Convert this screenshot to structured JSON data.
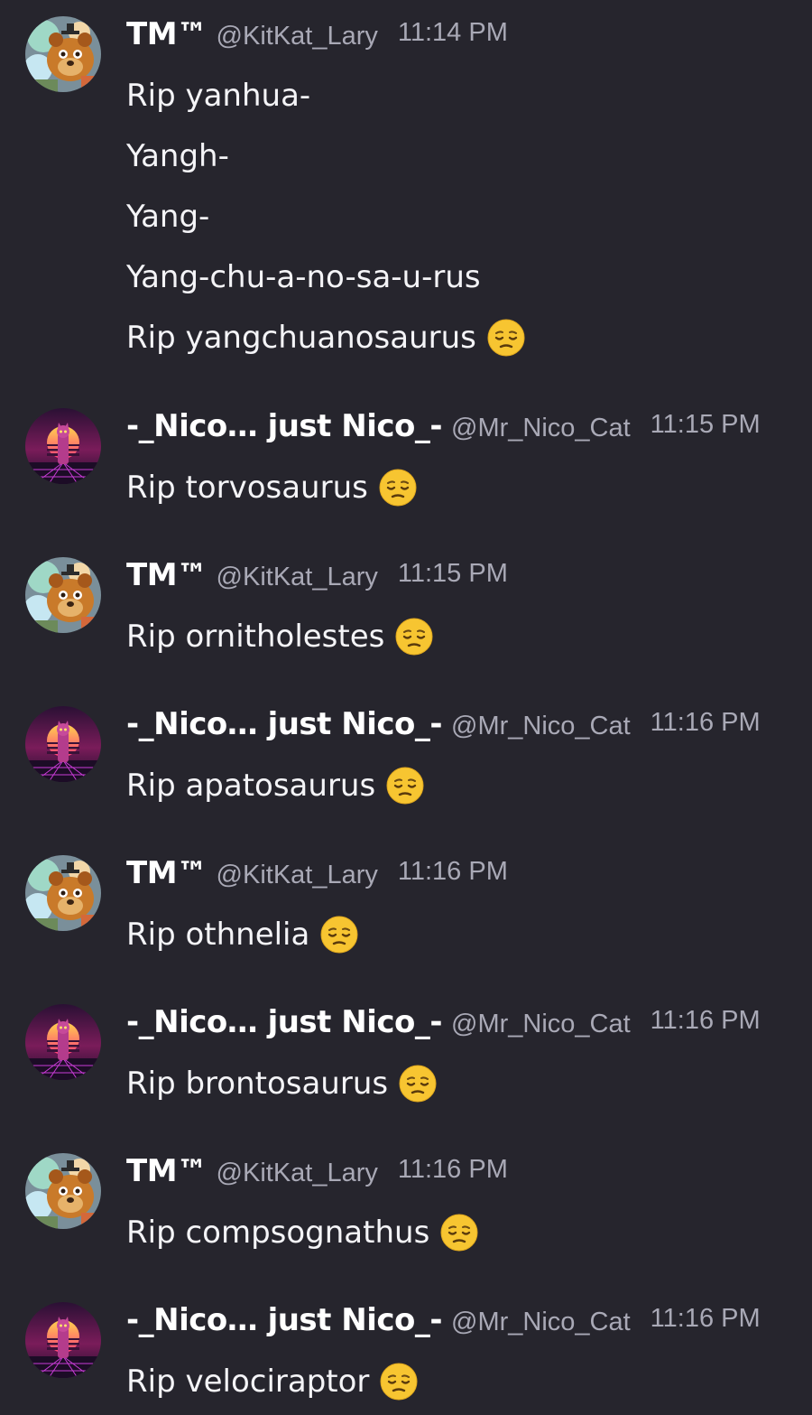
{
  "users": {
    "tm": {
      "display_name": "TM™",
      "handle": "@KitKat_Lary",
      "avatar": "bear-animatronic-avatar"
    },
    "nico": {
      "display_name": "-_Nico… just Nico_-",
      "handle": "@Mr_Nico_Cat",
      "avatar": "synthwave-cat-avatar"
    }
  },
  "colors": {
    "background": "#26252d",
    "message_text": "#f4f4f7",
    "meta_text": "#a9a9b6",
    "emoji_face": "#f7c531"
  },
  "emoji": "pensive-face-icon",
  "messages": [
    {
      "author": "tm",
      "display_name": "TM™",
      "handle": "@KitKat_Lary",
      "time": "11:14 PM",
      "lines": [
        {
          "text": "Rip yanhua-",
          "emoji": false
        },
        {
          "text": "Yangh-",
          "emoji": false
        },
        {
          "text": "Yang-",
          "emoji": false
        },
        {
          "text": "Yang-chu-a-no-sa-u-rus",
          "emoji": false
        },
        {
          "text": "Rip yangchuanosaurus",
          "emoji": true
        }
      ]
    },
    {
      "author": "nico",
      "display_name": "-_Nico… just Nico_-",
      "handle": "@Mr_Nico_Cat",
      "time": "11:15 PM",
      "lines": [
        {
          "text": "Rip torvosaurus",
          "emoji": true
        }
      ]
    },
    {
      "author": "tm",
      "display_name": "TM™",
      "handle": "@KitKat_Lary",
      "time": "11:15 PM",
      "lines": [
        {
          "text": "Rip ornitholestes",
          "emoji": true
        }
      ]
    },
    {
      "author": "nico",
      "display_name": "-_Nico… just Nico_-",
      "handle": "@Mr_Nico_Cat",
      "time": "11:16 PM",
      "lines": [
        {
          "text": "Rip apatosaurus",
          "emoji": true
        }
      ]
    },
    {
      "author": "tm",
      "display_name": "TM™",
      "handle": "@KitKat_Lary",
      "time": "11:16 PM",
      "lines": [
        {
          "text": "Rip othnelia",
          "emoji": true
        }
      ]
    },
    {
      "author": "nico",
      "display_name": "-_Nico… just Nico_-",
      "handle": "@Mr_Nico_Cat",
      "time": "11:16 PM",
      "lines": [
        {
          "text": "Rip brontosaurus",
          "emoji": true
        }
      ]
    },
    {
      "author": "tm",
      "display_name": "TM™",
      "handle": "@KitKat_Lary",
      "time": "11:16 PM",
      "lines": [
        {
          "text": "Rip compsognathus",
          "emoji": true
        }
      ]
    },
    {
      "author": "nico",
      "display_name": "-_Nico… just Nico_-",
      "handle": "@Mr_Nico_Cat",
      "time": "11:16 PM",
      "lines": [
        {
          "text": "Rip velociraptor",
          "emoji": true
        }
      ]
    }
  ]
}
